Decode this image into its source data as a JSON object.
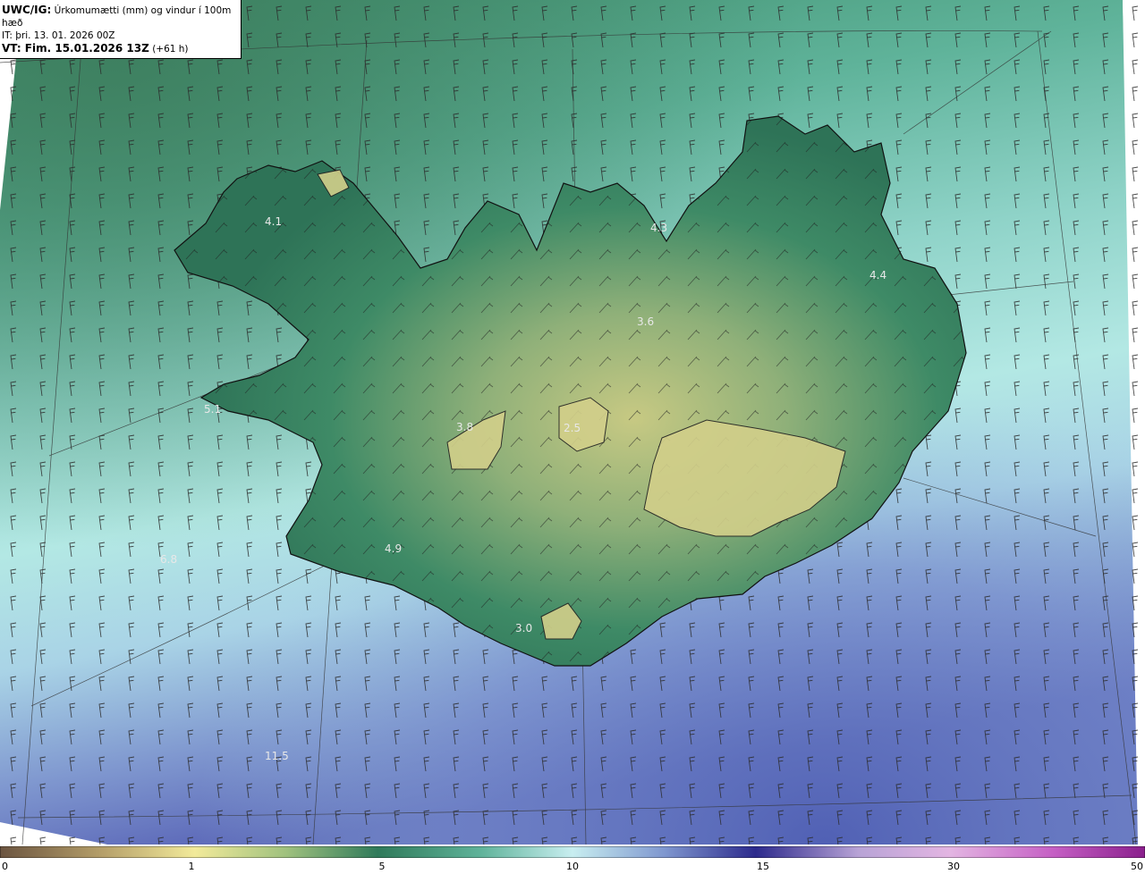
{
  "header": {
    "product_bold": "UWC/IG:",
    "product_desc": "Úrkomumætti (mm) og vindur í 100m hæð",
    "init_time": "IT: þri. 13. 01. 2026 00Z",
    "valid_bold": "VT: Fim. 15.01.2026 13Z",
    "valid_lead": "(+61 h)"
  },
  "map_labels": [
    {
      "name": "value-label-4-1",
      "text": "4.1"
    },
    {
      "name": "value-label-4-3",
      "text": "4.3"
    },
    {
      "name": "value-label-4-4",
      "text": "4.4"
    },
    {
      "name": "value-label-3-6",
      "text": "3.6"
    },
    {
      "name": "value-label-5-1",
      "text": "5.1"
    },
    {
      "name": "value-label-3-8",
      "text": "3.8"
    },
    {
      "name": "value-label-2-5",
      "text": "2.5"
    },
    {
      "name": "value-label-4-9",
      "text": "4.9"
    },
    {
      "name": "value-label-6-8",
      "text": "6.8"
    },
    {
      "name": "value-label-3-0",
      "text": "3.0"
    },
    {
      "name": "value-label-11-5",
      "text": "11.5"
    }
  ],
  "colorbar": {
    "ticks": [
      "0",
      "1",
      "5",
      "10",
      "15",
      "30",
      "50"
    ],
    "colors": {
      "sea_low": "#3f8a68",
      "land_green": "#2f7a5a",
      "land_dry": "#c9c97f",
      "sea_mid": "#9fdcd4",
      "sea_light": "#c8eef0",
      "sea_blue": "#6f86c8",
      "sea_violet": "#5b63b8",
      "coast_line": "#1a1a1a",
      "wind_barb": "#222222"
    }
  }
}
